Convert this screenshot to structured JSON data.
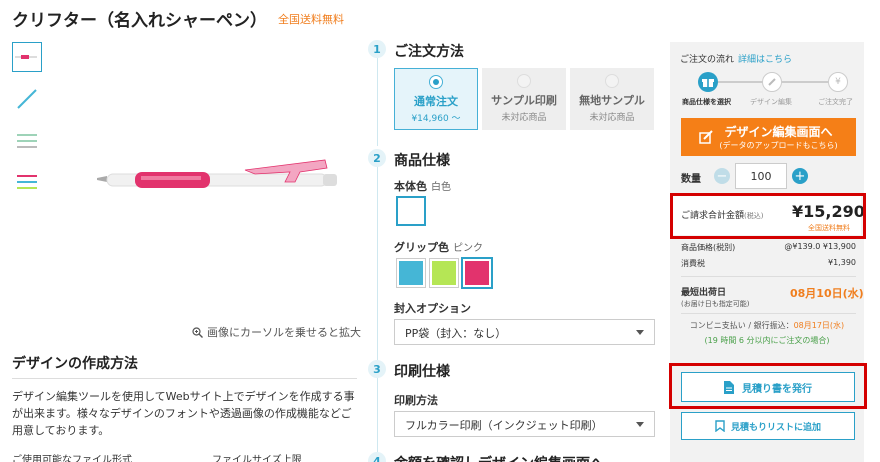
{
  "product": {
    "title": "クリフター（名入れシャーペン）",
    "free_shipping": "全国送料無料",
    "zoom_hint": "画像にカーソルを乗せると拡大"
  },
  "left": {
    "design_title": "デザインの作成方法",
    "design_desc": "デザイン編集ツールを使用してWebサイト上でデザインを作成する事が出来ます。様々なデザインのフォントや透過画像の作成機能などご用意しております。",
    "col1": "ご使用可能なファイル形式",
    "col2": "ファイルサイズ上限"
  },
  "steps": {
    "s1": {
      "num": "1",
      "title": "ご注文方法"
    },
    "s2": {
      "num": "2",
      "title": "商品仕様"
    },
    "s3": {
      "num": "3",
      "title": "印刷仕様"
    },
    "s4": {
      "num": "4",
      "title": "金額を確認しデザイン編集画面へ"
    }
  },
  "order_options": [
    {
      "name": "通常注文",
      "sub": "¥14,960 〜"
    },
    {
      "name": "サンプル印刷",
      "sub": "未対応商品"
    },
    {
      "name": "無地サンプル",
      "sub": "未対応商品"
    }
  ],
  "spec": {
    "body_color_label": "本体色",
    "body_color_value": "白色",
    "grip_color_label": "グリップ色",
    "grip_color_value": "ピンク",
    "grip_colors": [
      "#45b6d6",
      "#b5e655",
      "#e2336d"
    ],
    "packing_label": "封入オプション",
    "packing_value": "PP袋（封入：なし）"
  },
  "print": {
    "method_label": "印刷方法",
    "method_value": "フルカラー印刷（インクジェット印刷）"
  },
  "panel": {
    "flow_title": "ご注文の流れ",
    "flow_link": "詳細はこちら",
    "flow_steps": [
      "商品仕様を選択",
      "デザイン編集",
      "ご注文完了"
    ],
    "design_btn": "デザイン編集画面へ",
    "design_btn_sub": "(データのアップロードもこちら)",
    "qty_label": "数量",
    "qty_value": "100",
    "total_label": "ご請求合計金額",
    "total_tax": "(税込)",
    "total_value": "¥15,290",
    "total_ship": "全国送料無料",
    "price_label": "商品価格(税別)",
    "price_value": "@¥139.0 ¥13,900",
    "tax_label": "消費税",
    "tax_value": "¥1,390",
    "ship_label": "最短出荷日",
    "ship_sub": "(お届け日も指定可能)",
    "ship_date": "08月10日(水)",
    "conv_text": "コンビニ支払い / 銀行振込：",
    "conv_date": "08月17日(水)",
    "conv_note": "(19 時間 6 分以内にご注文の場合)",
    "quote_btn": "見積り書を発行",
    "list_btn": "見積もりリストに追加"
  },
  "colors": {
    "accent": "#2aa0c8",
    "orange": "#f57f17",
    "highlight": "#d40000"
  }
}
